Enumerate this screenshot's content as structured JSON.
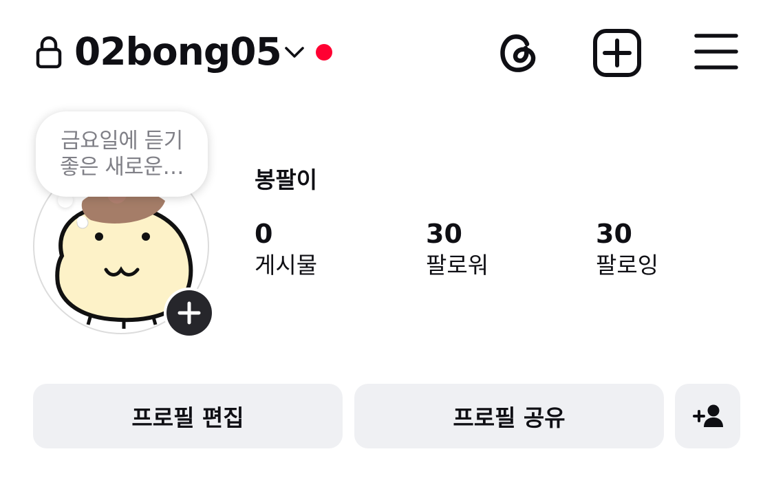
{
  "header": {
    "username": "02bong05",
    "icons": [
      "lock-icon",
      "chevron-down-icon",
      "threads-icon",
      "create-icon",
      "menu-icon"
    ],
    "notification_dot_color": "#ff0032"
  },
  "note": {
    "text_line1": "금요일에 듣기",
    "text_line2": "좋은 새로운…"
  },
  "profile": {
    "display_name": "봉팔이",
    "stats": [
      {
        "value": "0",
        "label": "게시물"
      },
      {
        "value": "30",
        "label": "팔로워"
      },
      {
        "value": "30",
        "label": "팔로잉"
      }
    ]
  },
  "actions": {
    "edit_label": "프로필 편집",
    "share_label": "프로필 공유",
    "add_person_icon": "add-person-icon"
  }
}
